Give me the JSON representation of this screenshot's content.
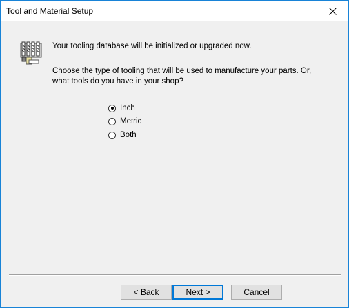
{
  "window": {
    "title": "Tool and Material Setup"
  },
  "icons": {
    "close": "close-icon",
    "tooling": "tooling-database-icon"
  },
  "content": {
    "message1": "Your tooling database will be initialized or upgraded now.",
    "message2_line1": "Choose the type of tooling that will be used to manufacture your parts.  Or,",
    "message2_line2": "what tools do you have in your shop?"
  },
  "tooling_options": {
    "selected": "Inch",
    "items": [
      {
        "label": "Inch",
        "checked": true
      },
      {
        "label": "Metric",
        "checked": false
      },
      {
        "label": "Both",
        "checked": false
      }
    ]
  },
  "buttons": {
    "back": "< Back",
    "next": "Next >",
    "cancel": "Cancel"
  },
  "colors": {
    "window_border": "#1883d7",
    "dialog_background": "#f0f0f0",
    "default_button_border": "#0078d7"
  }
}
